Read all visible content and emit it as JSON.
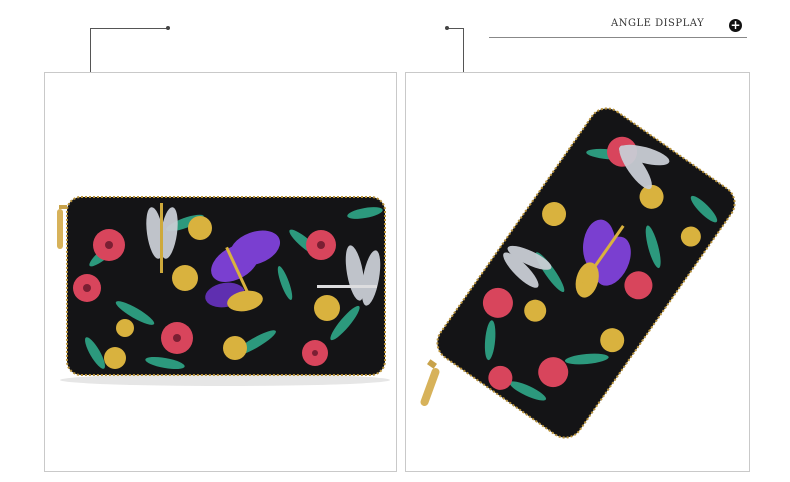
{
  "header": {
    "label": "ANGLE DISPLAY",
    "action_icon": "plus-circle-icon"
  },
  "colors": {
    "leather": "#141416",
    "leaf": "#2fa889",
    "rose": "#d8455c",
    "gold": "#d9b23e",
    "butterfly": "#7a3fd0",
    "silver": "#c9cdd4"
  },
  "panels": [
    {
      "view": "front"
    },
    {
      "view": "angled"
    }
  ]
}
